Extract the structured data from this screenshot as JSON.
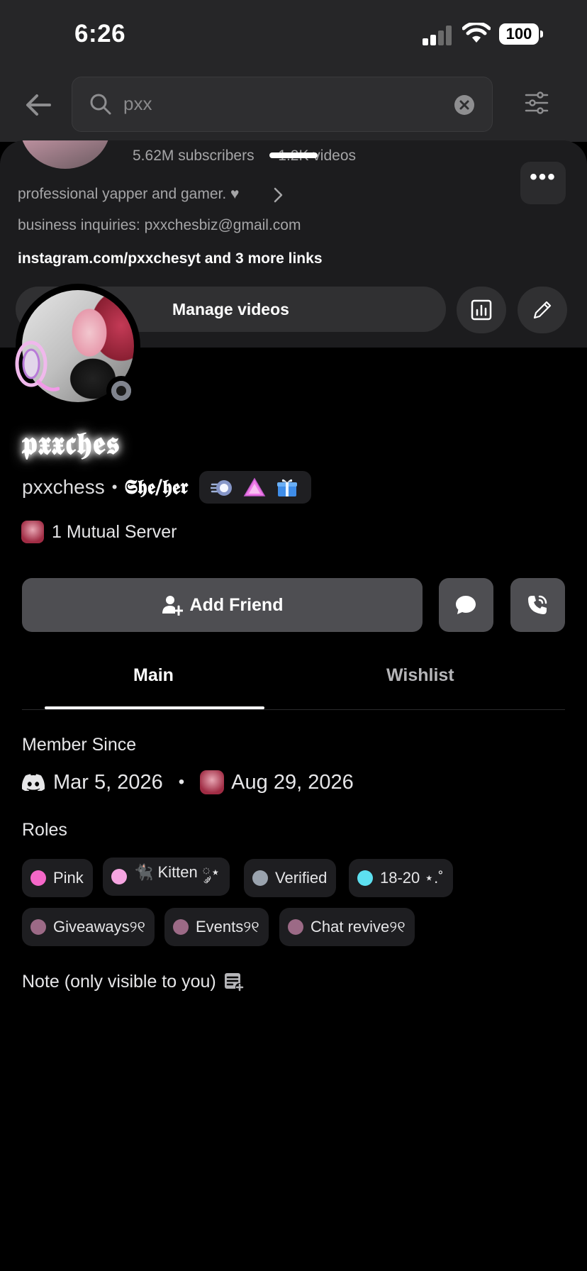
{
  "status_bar": {
    "time": "6:26",
    "battery": "100"
  },
  "search": {
    "query": "pxx"
  },
  "channel": {
    "stats_left": "5.62M subscribers",
    "stats_right": "1.2K videos",
    "description": "professional yapper and gamer. ♥",
    "business": "business inquiries: pxxchesbiz@gmail.com",
    "links": "instagram.com/pxxchesyt and 3 more links",
    "manage_label": "Manage videos",
    "more_label": "•••"
  },
  "profile": {
    "display_name": "𝖕𝖝𝖝𝖈𝖍𝖊𝖘",
    "username": "pxxchess",
    "separator": "•",
    "pronouns": "𝕾𝖍𝖊/𝖍𝖊𝖗",
    "badges": [
      "nitro-boost-badge",
      "triangle-badge",
      "gift-badge"
    ],
    "mutual_servers": "1 Mutual Server",
    "add_friend_label": "Add Friend"
  },
  "tabs": {
    "main": "Main",
    "wishlist": "Wishlist"
  },
  "member_since": {
    "label": "Member Since",
    "discord_date": "Mar 5, 2026",
    "separator": "•",
    "server_date": "Aug 29, 2026"
  },
  "roles": {
    "label": "Roles",
    "items": [
      {
        "label": "Pink",
        "color": "#f567c8"
      },
      {
        "label": "🐈‍⬛ Kitten ༘⋆",
        "color": "#f6a5e1"
      },
      {
        "label": "Verified",
        "color": "#9aa3ae"
      },
      {
        "label": "18-20 ⋆.˚",
        "color": "#5de0f0"
      },
      {
        "label": "Giveaways୨୧",
        "color": "#9c6a86"
      },
      {
        "label": "Events୨୧",
        "color": "#9c6a86"
      },
      {
        "label": "Chat revive୨୧",
        "color": "#9c6a86"
      }
    ]
  },
  "note": {
    "label": "Note (only visible to you)"
  },
  "colors": {
    "background": "#000000",
    "button": "#4e4e52",
    "role_pill": "#1e1e21",
    "header": "#262628"
  }
}
